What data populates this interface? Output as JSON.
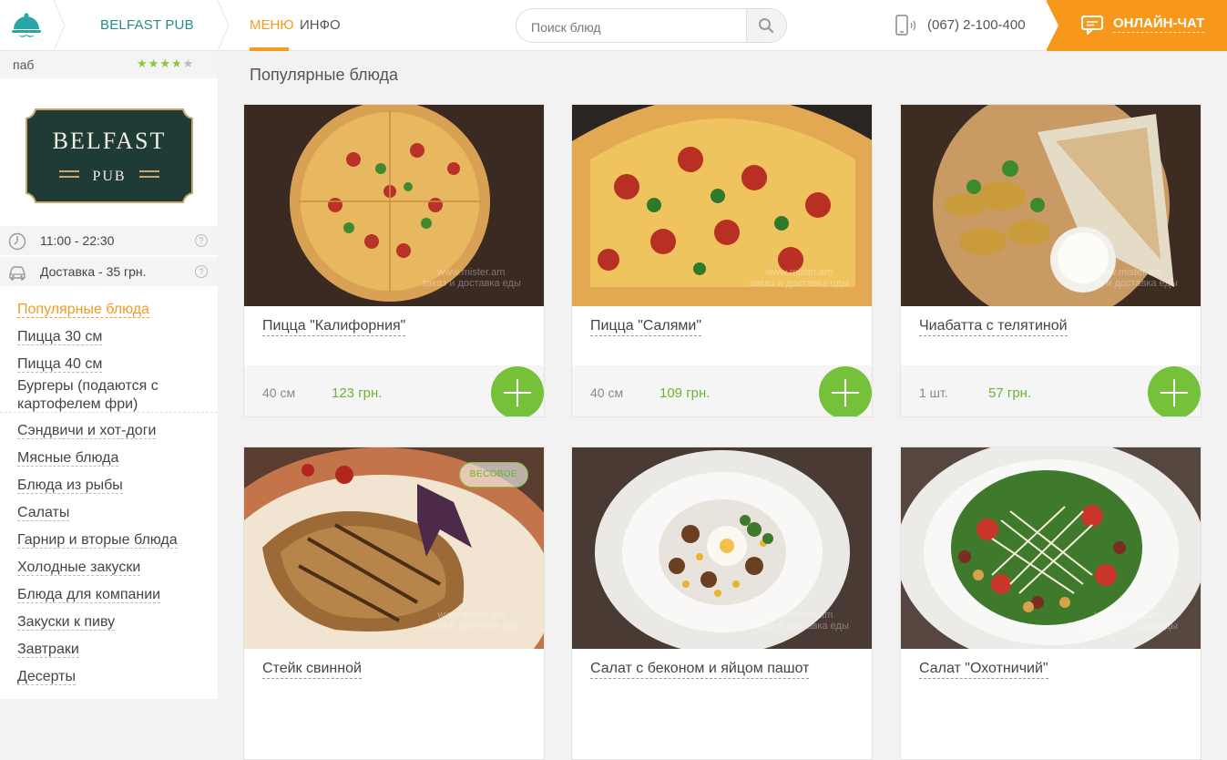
{
  "header": {
    "restaurant_name": "BELFAST PUB",
    "tabs": [
      {
        "label": "МЕНЮ",
        "active": true
      },
      {
        "label": "ИНФО",
        "active": false
      }
    ],
    "search_placeholder": "Поиск блюд",
    "phone": "(067) 2-100-400",
    "chat_label": "ОНЛАЙН-ЧАТ",
    "accent_color": "#f7981d",
    "brand_color": "#2a8a8a"
  },
  "sidebar": {
    "type": "паб",
    "rating": {
      "value": 4,
      "max": 5
    },
    "logo_text": {
      "line1": "BELFAST",
      "line2": "PUB"
    },
    "hours": "11:00 - 22:30",
    "delivery": "Доставка - 35 грн.",
    "help_mark": "?",
    "categories": [
      {
        "label": "Популярные блюда",
        "active": true
      },
      {
        "label": "Пицца 30 см"
      },
      {
        "label": "Пицца 40 см"
      },
      {
        "label": "Бургеры (подаются с картофелем фри)"
      },
      {
        "label": "Сэндвичи и хот-доги"
      },
      {
        "label": "Мясные блюда"
      },
      {
        "label": "Блюда из рыбы"
      },
      {
        "label": "Салаты"
      },
      {
        "label": "Гарнир и вторые блюда"
      },
      {
        "label": "Холодные закуски"
      },
      {
        "label": "Блюда для компании"
      },
      {
        "label": "Закуски к пиву"
      },
      {
        "label": "Завтраки"
      },
      {
        "label": "Десерты"
      }
    ]
  },
  "main": {
    "section_title": "Популярные блюда",
    "watermark": {
      "line1": "www.mister.am",
      "line2": "заказ и доставка еды"
    },
    "cards": [
      {
        "name": "Пицца \"Калифорния\"",
        "size": "40 см",
        "price": "123 грн."
      },
      {
        "name": "Пицца \"Салями\"",
        "size": "40 см",
        "price": "109 грн."
      },
      {
        "name": "Чиабатта с телятиной",
        "size": "1 шт.",
        "price": "57 грн."
      },
      {
        "name": "Стейк свинной",
        "badge": "ВЕСОВОЕ"
      },
      {
        "name": "Салат с беконом и яйцом пашот"
      },
      {
        "name": "Салат \"Охотничий\""
      }
    ]
  }
}
